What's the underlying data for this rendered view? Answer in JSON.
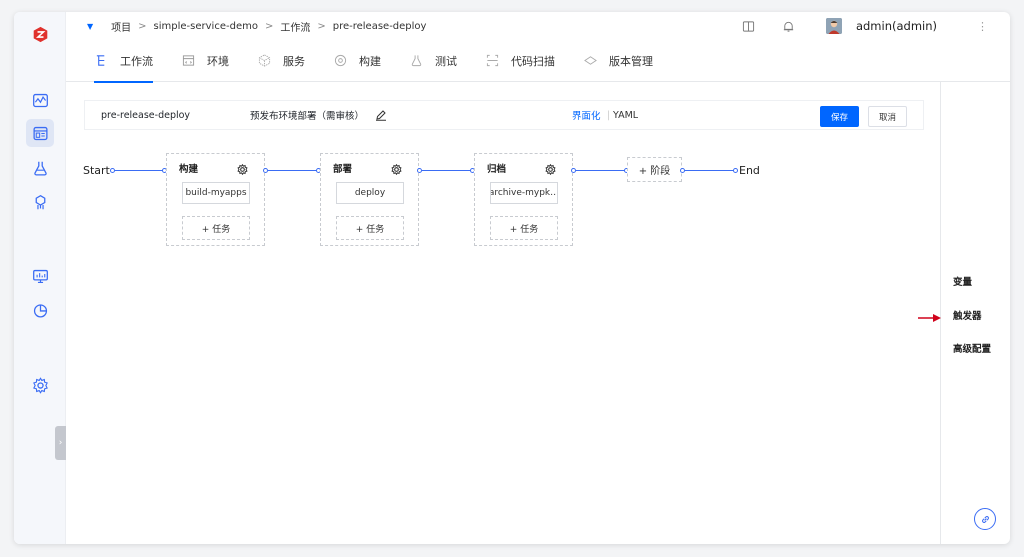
{
  "app": {
    "logo_icon": "zadig-logo-icon",
    "accent": "#0066ff",
    "brand": "#e0322d"
  },
  "breadcrumb": {
    "items": [
      "项目",
      "simple-service-demo",
      "工作流",
      "pre-release-deploy"
    ],
    "separator": ">"
  },
  "user": {
    "name": "admin(admin)"
  },
  "tabs": [
    {
      "label": "工作流",
      "icon": "workflow-icon",
      "active": true
    },
    {
      "label": "环境",
      "icon": "environment-icon"
    },
    {
      "label": "服务",
      "icon": "service-icon"
    },
    {
      "label": "构建",
      "icon": "build-icon"
    },
    {
      "label": "测试",
      "icon": "flask-icon"
    },
    {
      "label": "代码扫描",
      "icon": "scan-icon"
    },
    {
      "label": "版本管理",
      "icon": "version-icon"
    }
  ],
  "workflow": {
    "name": "pre-release-deploy",
    "description": "预发布环境部署（需审核）",
    "mode_ui": "界面化",
    "mode_yaml": "YAML",
    "save_label": "保存",
    "cancel_label": "取消"
  },
  "flow": {
    "start_label": "Start",
    "end_label": "End",
    "add_stage_label": "+ 阶段",
    "stages": [
      {
        "title": "构建",
        "job": "build-myapps",
        "add_task": "+ 任务"
      },
      {
        "title": "部署",
        "job": "deploy",
        "add_task": "+ 任务"
      },
      {
        "title": "归档",
        "job": "archive-mypk…",
        "add_task": "+ 任务"
      }
    ]
  },
  "right_panel": {
    "items": [
      "变量",
      "触发器",
      "高级配置"
    ]
  }
}
